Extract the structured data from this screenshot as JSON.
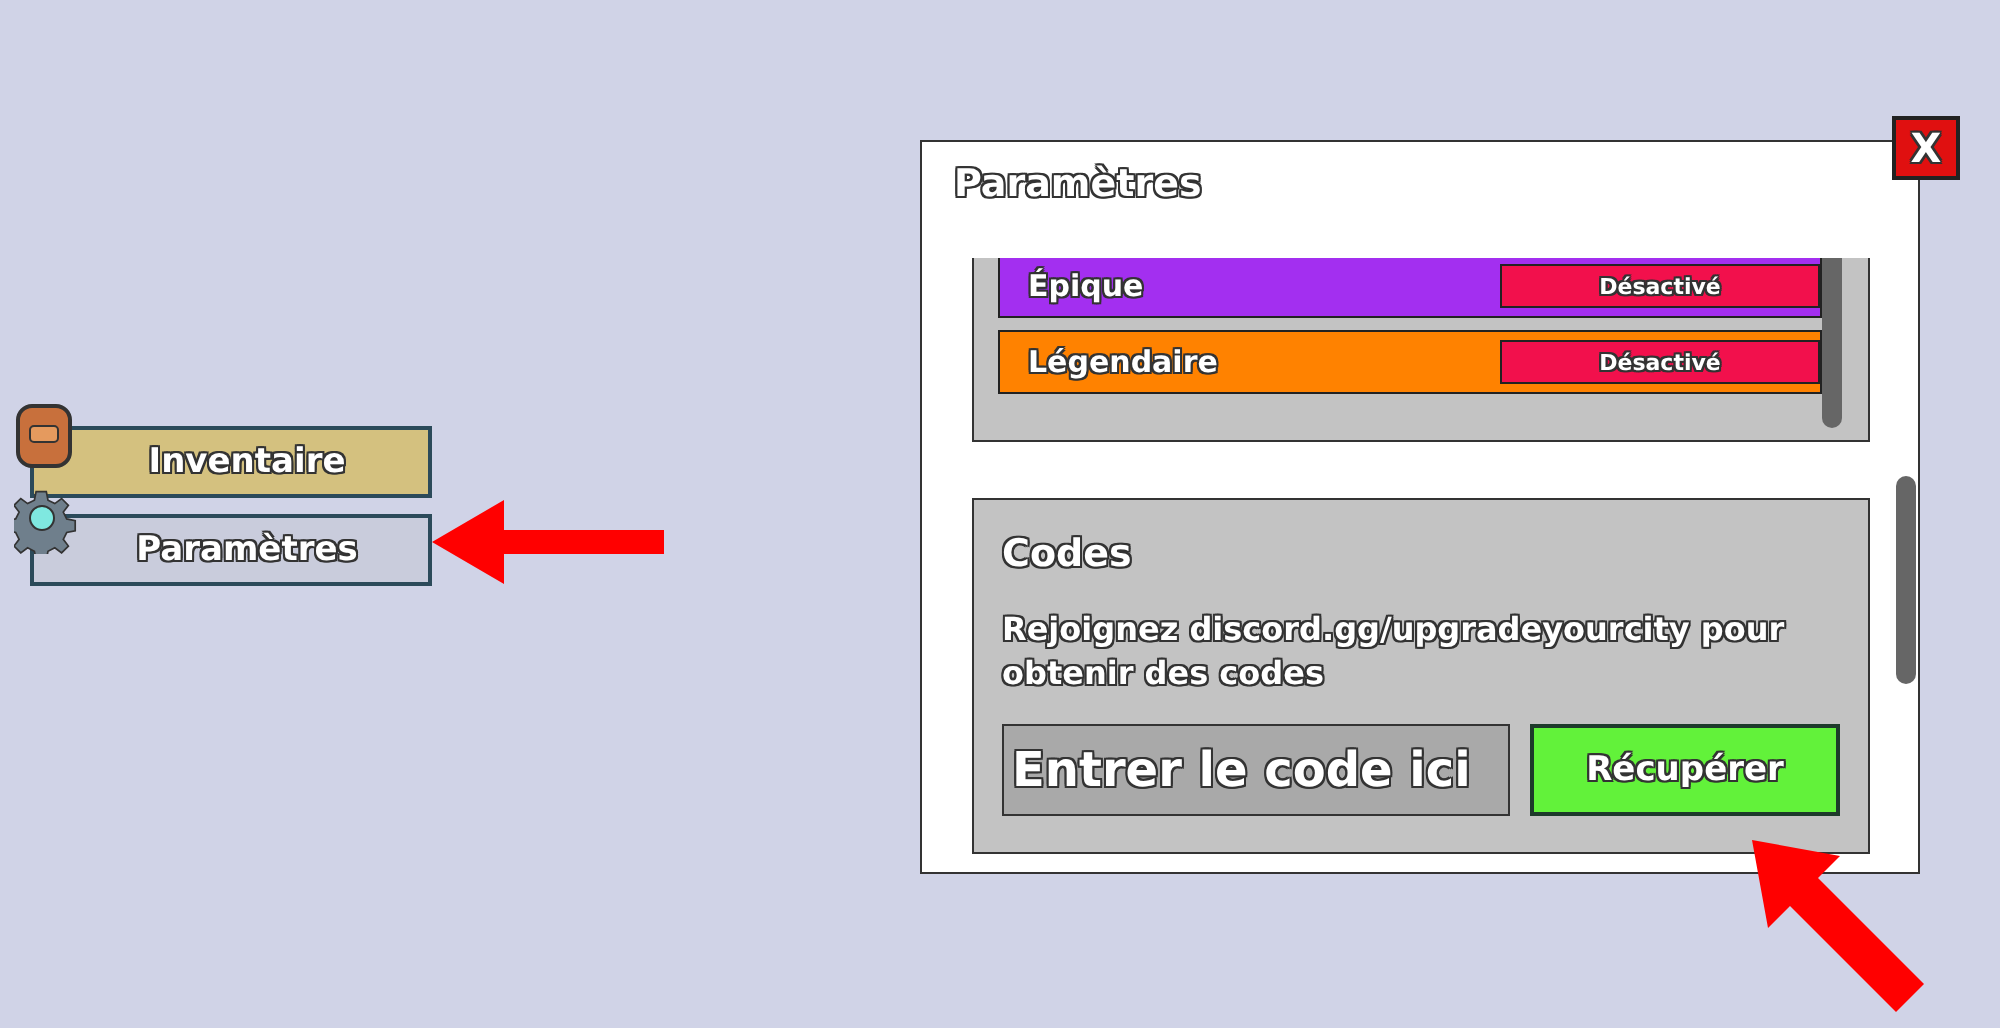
{
  "menu": [
    {
      "label": "Inventaire",
      "color": "#d4c17f"
    },
    {
      "label": "Paramètres",
      "color": "#c9ccdc"
    }
  ],
  "settings": {
    "title": "Paramètres",
    "close": "X",
    "rarities": [
      {
        "name": "Épique",
        "color": "#a32ff0",
        "toggle": {
          "label": "Désactivé",
          "on": false
        }
      },
      {
        "name": "Légendaire",
        "color": "#ff8200",
        "toggle": {
          "label": "Désactivé",
          "on": false
        }
      }
    ],
    "codes": {
      "title": "Codes",
      "text": "Rejoignez discord.gg/upgradeyourcity pour obtenir des codes",
      "placeholder": "Entrer le code ici",
      "button": "Récupérer"
    }
  }
}
